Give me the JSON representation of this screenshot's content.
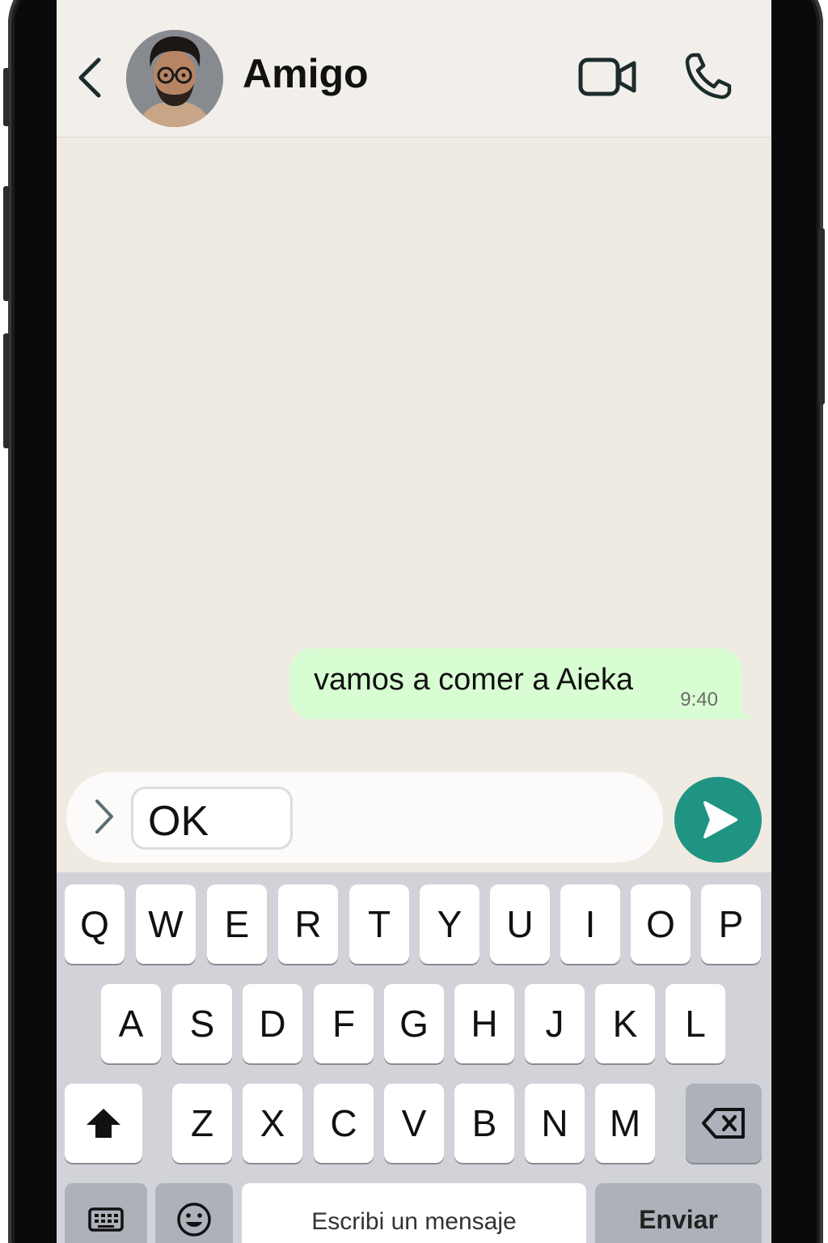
{
  "header": {
    "contact_name": "Amigo"
  },
  "icons": {
    "back": "back-chevron-icon",
    "avatar": "contact-avatar",
    "video": "video-camera-icon",
    "call": "phone-icon",
    "expand": "chevron-right-icon",
    "send": "send-arrow-icon",
    "shift": "shift-arrow-icon",
    "backspace": "backspace-icon",
    "keyboard": "keyboard-icon",
    "emoji": "emoji-icon"
  },
  "messages": [
    {
      "text": "vamos a comer a Aieka",
      "time": "9:40",
      "outgoing": true
    }
  ],
  "composer": {
    "draft_text": "OK"
  },
  "keyboard": {
    "row1": [
      "Q",
      "W",
      "E",
      "R",
      "T",
      "Y",
      "U",
      "I",
      "O",
      "P"
    ],
    "row2": [
      "A",
      "S",
      "D",
      "F",
      "G",
      "H",
      "J",
      "K",
      "L"
    ],
    "row3": [
      "Z",
      "X",
      "C",
      "V",
      "B",
      "N",
      "M"
    ],
    "space_label": "Escribi un mensaje",
    "enter_label": "Enviar"
  },
  "colors": {
    "accent": "#1f9483",
    "outgoing_bubble": "#d9fdd3",
    "chat_background": "#efeae2",
    "header_background": "#f2efeb",
    "keyboard_background": "#d1d3d9"
  }
}
